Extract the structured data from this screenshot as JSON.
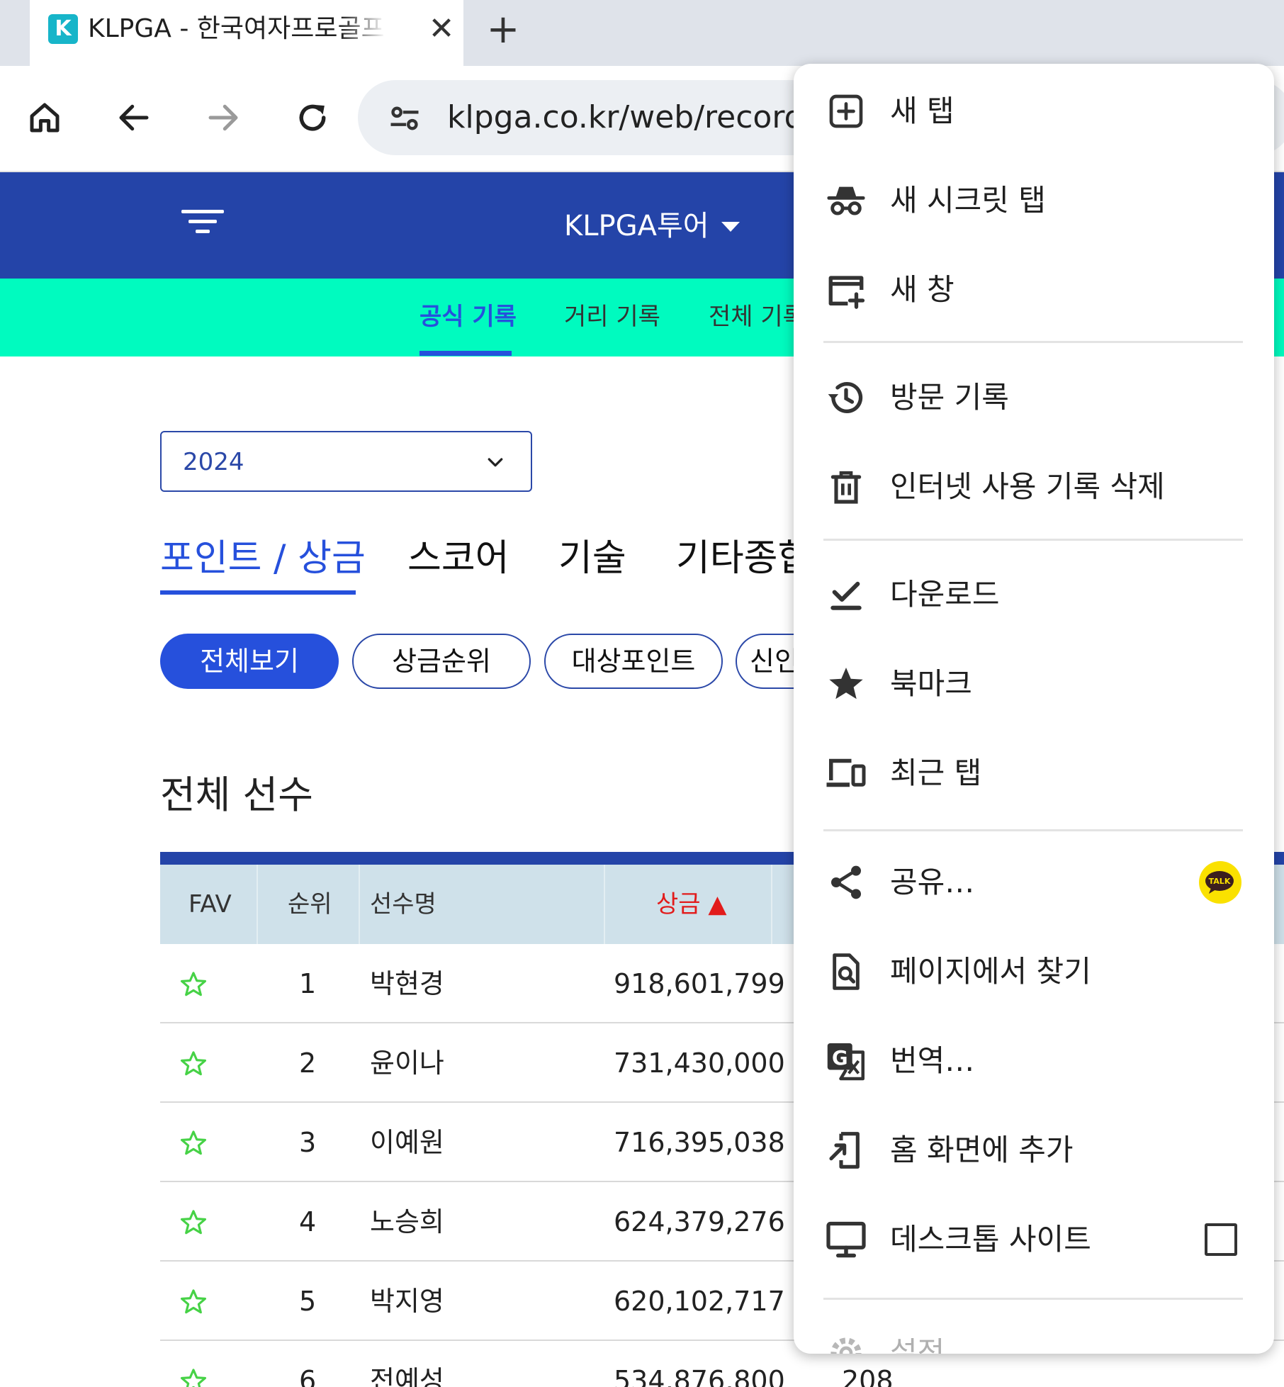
{
  "browser": {
    "tab_title": "KLPGA - 한국여자프로골프협회",
    "tab_favicon_letter": "K",
    "url": "klpga.co.kr/web/record/p"
  },
  "site": {
    "title": "KLPGA투어",
    "subnav": [
      "공식 기록",
      "거리 기록",
      "전체 기록"
    ],
    "year": "2024",
    "main_tabs": [
      "포인트 / 상금",
      "스코어",
      "기술",
      "기타종합"
    ],
    "chips": [
      "전체보기",
      "상금순위",
      "대상포인트",
      "신인"
    ],
    "section_title": "전체 선수"
  },
  "table": {
    "headers": {
      "fav": "FAV",
      "rank": "순위",
      "name": "선수명",
      "prize": "상금 ▲"
    },
    "rows": [
      {
        "rank": "1",
        "name": "박현경",
        "prize": "918,601,799"
      },
      {
        "rank": "2",
        "name": "윤이나",
        "prize": "731,430,000"
      },
      {
        "rank": "3",
        "name": "이예원",
        "prize": "716,395,038"
      },
      {
        "rank": "4",
        "name": "노승희",
        "prize": "624,379,276"
      },
      {
        "rank": "5",
        "name": "박지영",
        "prize": "620,102,717"
      },
      {
        "rank": "6",
        "name": "전예성",
        "prize": "534,876,800",
        "extra": "208"
      }
    ]
  },
  "menu": {
    "items": [
      {
        "label": "새 탭",
        "icon": "new-tab-icon"
      },
      {
        "label": "새 시크릿 탭",
        "icon": "incognito-icon"
      },
      {
        "label": "새 창",
        "icon": "new-window-icon"
      },
      {
        "label": "방문 기록",
        "icon": "history-icon"
      },
      {
        "label": "인터넷 사용 기록 삭제",
        "icon": "trash-icon"
      },
      {
        "label": "다운로드",
        "icon": "download-icon"
      },
      {
        "label": "북마크",
        "icon": "star-icon"
      },
      {
        "label": "최근 탭",
        "icon": "devices-icon"
      },
      {
        "label": "공유…",
        "icon": "share-icon"
      },
      {
        "label": "페이지에서 찾기",
        "icon": "find-icon"
      },
      {
        "label": "번역…",
        "icon": "translate-icon"
      },
      {
        "label": "홈 화면에 추가",
        "icon": "add-to-home-icon"
      },
      {
        "label": "데스크톱 사이트",
        "icon": "desktop-icon"
      },
      {
        "label": "설정",
        "icon": "gear-icon"
      }
    ],
    "kakao_label": "TALK"
  },
  "colors": {
    "header_blue": "#2444a8",
    "accent_blue": "#2650dc",
    "subnav_green": "#00fbbf",
    "sort_red": "#e21b1b",
    "star_green": "#46d246",
    "kakao_yellow": "#fae100"
  }
}
